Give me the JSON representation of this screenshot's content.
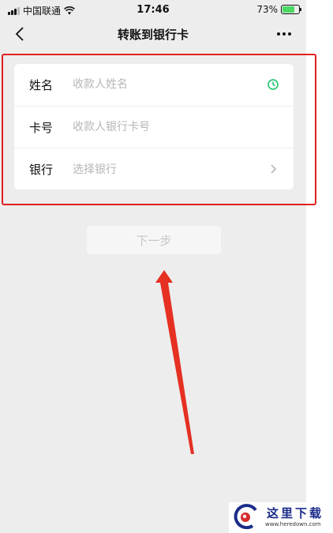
{
  "status_bar": {
    "carrier": "中国联通",
    "time": "17:46",
    "battery_percent": "73%",
    "battery_level": 0.73
  },
  "nav": {
    "title": "转账到银行卡"
  },
  "form": {
    "name_label": "姓名",
    "name_placeholder": "收款人姓名",
    "card_label": "卡号",
    "card_placeholder": "收款人银行卡号",
    "bank_label": "银行",
    "bank_placeholder": "选择银行"
  },
  "next_button": {
    "label": "下一步"
  },
  "watermark": {
    "text": "这里下载",
    "url": "www.heredown.com"
  },
  "colors": {
    "background": "#ededed",
    "card": "#ffffff",
    "annotation_red": "#e02020",
    "accent_green": "#07c160"
  }
}
